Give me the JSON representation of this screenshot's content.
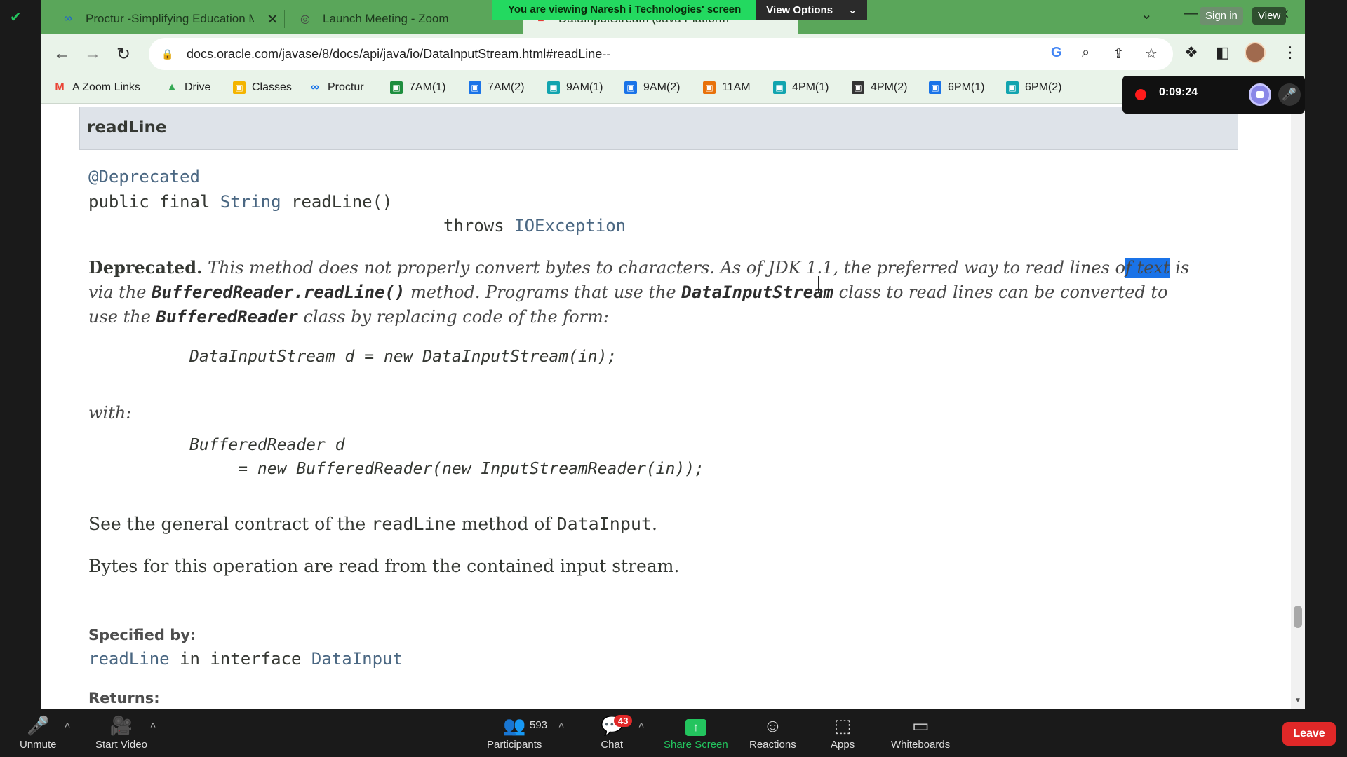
{
  "browser": {
    "tabs": [
      {
        "label": "Proctur -Simplifying Education M",
        "icon": "proctur-icon"
      },
      {
        "label": "Launch Meeting - Zoom",
        "icon": "globe-icon"
      },
      {
        "label": "DataInputStream (Java Platform",
        "icon": "java-icon"
      }
    ],
    "url": "docs.oracle.com/javase/8/docs/api/java/io/DataInputStream.html#readLine--",
    "bookmarks": [
      {
        "label": "A Zoom Links",
        "color": "#ea4335",
        "glyph": "M"
      },
      {
        "label": "Drive",
        "color": "#34a853",
        "glyph": "▲"
      },
      {
        "label": "Classes",
        "color": "#f4b400",
        "glyph": "▣"
      },
      {
        "label": "Proctur",
        "color": "#1a73e8",
        "glyph": "∞"
      },
      {
        "label": "7AM(1)",
        "color": "#1e8e3e",
        "glyph": "▣"
      },
      {
        "label": "7AM(2)",
        "color": "#1a73e8",
        "glyph": "▣"
      },
      {
        "label": "9AM(1)",
        "color": "#12a4af",
        "glyph": "▣"
      },
      {
        "label": "9AM(2)",
        "color": "#1a73e8",
        "glyph": "▣"
      },
      {
        "label": "11AM",
        "color": "#e8710a",
        "glyph": "▣"
      },
      {
        "label": "4PM(1)",
        "color": "#12a4af",
        "glyph": "▣"
      },
      {
        "label": "4PM(2)",
        "color": "#333333",
        "glyph": "▣"
      },
      {
        "label": "6PM(1)",
        "color": "#1a73e8",
        "glyph": "▣"
      },
      {
        "label": "6PM(2)",
        "color": "#12a4af",
        "glyph": "▣"
      }
    ]
  },
  "zoom_banner": {
    "viewing_text": "You are viewing Naresh i Technologies' screen",
    "view_options": "View Options",
    "sign_in": "Sign in",
    "view": "View"
  },
  "recording": {
    "time": "0:09:24"
  },
  "doc": {
    "member_title": "readLine",
    "annotation": "@Deprecated",
    "sig_line1_a": "public final ",
    "sig_line1_type": "String",
    "sig_line1_b": " readLine()",
    "sig_line2_a": "throws ",
    "sig_line2_type": "IOException",
    "deprecated_label": "Deprecated.",
    "dep_text_1": " This method does not properly convert bytes to characters. As of JDK 1.1, the preferred way to read lines o",
    "dep_selected": "f text",
    "dep_text_2": " is",
    "dep_line2_a": "via the ",
    "dep_line2_code": "BufferedReader.readLine()",
    "dep_line2_b": " method. Programs that use the ",
    "dep_line2_code2": "DataInputStream",
    "dep_line2_c": " class to read lines can be converted to",
    "dep_line3_a": "use the ",
    "dep_line3_code": "BufferedReader",
    "dep_line3_b": " class by replacing code of the form:",
    "code1": "DataInputStream d = new DataInputStream(in);",
    "with": "with:",
    "code2_line1": "BufferedReader d",
    "code2_line2": "     = new BufferedReader(new InputStreamReader(in));",
    "contract_a": "See the general contract of the ",
    "contract_code1": "readLine",
    "contract_b": " method of ",
    "contract_code2": "DataInput",
    "contract_c": ".",
    "bytes_text": "Bytes for this operation are read from the contained input stream.",
    "specified_by_label": "Specified by:",
    "spec_method": "readLine",
    "spec_in": " in interface ",
    "spec_iface": "DataInput",
    "returns_label": "Returns:"
  },
  "zoom_bar": {
    "unmute": "Unmute",
    "start_video": "Start Video",
    "participants": "Participants",
    "participants_count": "593",
    "chat": "Chat",
    "chat_badge": "43",
    "share_screen": "Share Screen",
    "reactions": "Reactions",
    "apps": "Apps",
    "whiteboards": "Whiteboards",
    "leave": "Leave"
  }
}
